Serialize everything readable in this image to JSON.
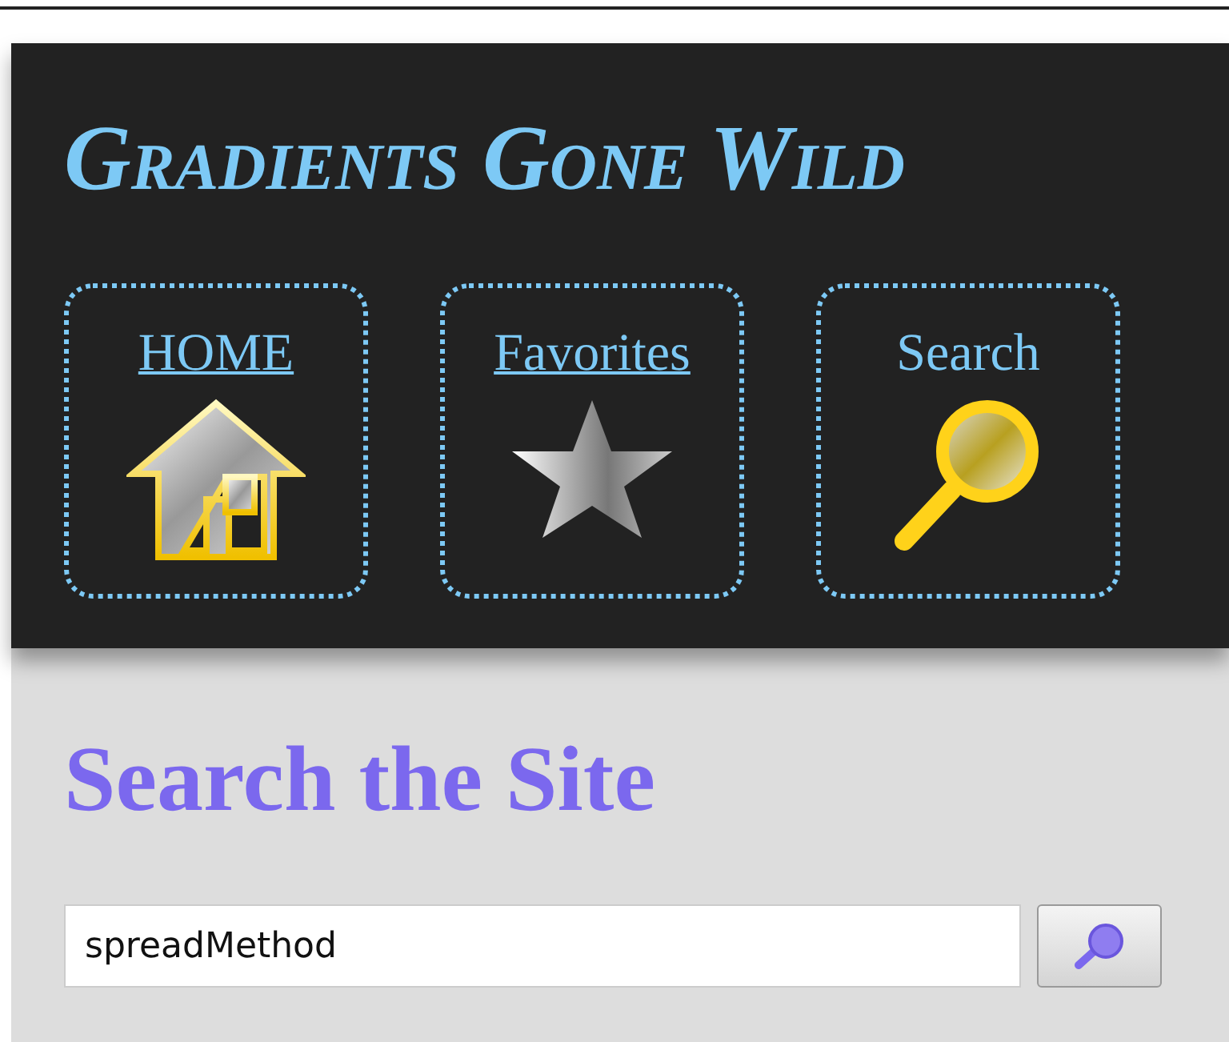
{
  "site_title": "Gradients Gone Wild",
  "nav": [
    {
      "label": "HOME",
      "kind": "home",
      "selected": false
    },
    {
      "label": "Favorites",
      "kind": "favorites",
      "selected": false
    },
    {
      "label": "Search",
      "kind": "search",
      "selected": true
    }
  ],
  "heading": "Search the Site",
  "search": {
    "value": "spreadMethod"
  }
}
